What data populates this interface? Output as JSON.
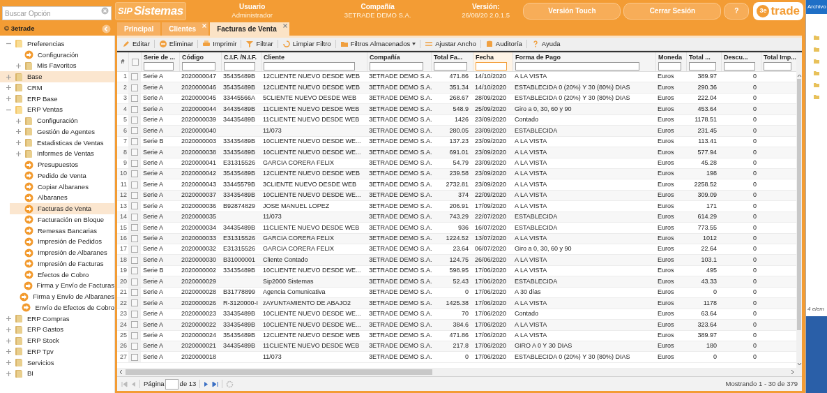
{
  "search": {
    "placeholder": "Buscar Opción"
  },
  "logo": {
    "mark": "SIP",
    "name": "Sistemas"
  },
  "header_fields": [
    {
      "label": "Usuario",
      "value": "Administrador"
    },
    {
      "label": "Compañía",
      "value": "3ETRADE DEMO S.A."
    },
    {
      "label": "Versión:",
      "value": "26/08/20 2.0.1.5"
    }
  ],
  "header_buttons": [
    "Versión Touch",
    "Cerrar Sesión",
    "?"
  ],
  "brand": {
    "mark": "3e",
    "name": "trade"
  },
  "sidebar_title": "© 3etrade",
  "tree": [
    {
      "label": "Preferencias",
      "kind": "folder",
      "expanded": true,
      "selected": false,
      "children": [
        {
          "label": "Configuración",
          "kind": "item",
          "selected": false
        },
        {
          "label": "Mis Favoritos",
          "kind": "folder",
          "expanded": false,
          "selected": false
        }
      ]
    },
    {
      "label": "Base",
      "kind": "folder",
      "expanded": false,
      "selected": true
    },
    {
      "label": "CRM",
      "kind": "folder",
      "expanded": false,
      "selected": false
    },
    {
      "label": "ERP Base",
      "kind": "folder",
      "expanded": false,
      "selected": false
    },
    {
      "label": "ERP Ventas",
      "kind": "folder",
      "expanded": true,
      "selected": false,
      "children": [
        {
          "label": "Configuración",
          "kind": "folder",
          "expanded": false,
          "selected": false
        },
        {
          "label": "Gestión de Agentes",
          "kind": "folder",
          "expanded": false,
          "selected": false
        },
        {
          "label": "Estadisticas de Ventas",
          "kind": "folder",
          "expanded": false,
          "selected": false
        },
        {
          "label": "Informes de Ventas",
          "kind": "folder",
          "expanded": false,
          "selected": false
        },
        {
          "label": "Presupuestos",
          "kind": "item",
          "selected": false
        },
        {
          "label": "Pedido de Venta",
          "kind": "item",
          "selected": false
        },
        {
          "label": "Copiar Albaranes",
          "kind": "item",
          "selected": false
        },
        {
          "label": "Albaranes",
          "kind": "item",
          "selected": false
        },
        {
          "label": "Facturas de Venta",
          "kind": "item",
          "selected": true
        },
        {
          "label": "Facturación en Bloque",
          "kind": "item",
          "selected": false
        },
        {
          "label": "Remesas Bancarias",
          "kind": "item",
          "selected": false
        },
        {
          "label": "Impresión de Pedidos",
          "kind": "item",
          "selected": false
        },
        {
          "label": "Impresión de Albaranes",
          "kind": "item",
          "selected": false
        },
        {
          "label": "Impresión de Facturas",
          "kind": "item",
          "selected": false
        },
        {
          "label": "Efectos de Cobro",
          "kind": "item",
          "selected": false
        },
        {
          "label": "Firma y Envío de Facturas",
          "kind": "item",
          "selected": false
        },
        {
          "label": "Firma y Envío de Albaranes",
          "kind": "item",
          "selected": false
        },
        {
          "label": "Envío de Efectos de Cobro",
          "kind": "item",
          "selected": false
        }
      ]
    },
    {
      "label": "ERP Compras",
      "kind": "folder",
      "expanded": false,
      "selected": false
    },
    {
      "label": "ERP Gastos",
      "kind": "folder",
      "expanded": false,
      "selected": false
    },
    {
      "label": "ERP Stock",
      "kind": "folder",
      "expanded": false,
      "selected": false
    },
    {
      "label": "ERP Tpv",
      "kind": "folder",
      "expanded": false,
      "selected": false
    },
    {
      "label": "Servicios",
      "kind": "folder",
      "expanded": false,
      "selected": false
    },
    {
      "label": "BI",
      "kind": "folder",
      "expanded": false,
      "selected": false
    }
  ],
  "tabs": [
    {
      "label": "Principal",
      "selected": false,
      "closable": false
    },
    {
      "label": "Clientes",
      "selected": false,
      "closable": true
    },
    {
      "label": "Facturas de Venta",
      "selected": true,
      "closable": true
    }
  ],
  "toolbar": [
    {
      "label": "Editar",
      "kind": "edit"
    },
    {
      "label": "Eliminar",
      "kind": "delete"
    },
    {
      "label": "Imprimir",
      "kind": "print"
    },
    {
      "label": "Filtrar",
      "kind": "filter"
    },
    {
      "label": "Limpiar Filtro",
      "kind": "clear"
    },
    {
      "label": "Filtros Almacenados",
      "kind": "stored"
    },
    {
      "label": "Ajustar Ancho",
      "kind": "width"
    },
    {
      "label": "Auditoría",
      "kind": "audit"
    },
    {
      "label": "Ayuda",
      "kind": "help"
    }
  ],
  "table": {
    "index_header": "#",
    "columns": [
      {
        "label": "Serie de ...",
        "kind": "text",
        "active": false
      },
      {
        "label": "Código",
        "kind": "text",
        "active": false
      },
      {
        "label": "C.I.F. /N.I.F.",
        "kind": "text",
        "active": false
      },
      {
        "label": "Cliente",
        "kind": "text",
        "active": false
      },
      {
        "label": "Compañía",
        "kind": "text",
        "active": false
      },
      {
        "label": "Total Fa...",
        "kind": "number",
        "active": false
      },
      {
        "label": "Fecha",
        "kind": "text",
        "active": true
      },
      {
        "label": "Forma de Pago",
        "kind": "text",
        "active": false
      },
      {
        "label": "Moneda",
        "kind": "text",
        "active": false
      },
      {
        "label": "Total ...",
        "kind": "number",
        "active": false
      },
      {
        "label": "Descu...",
        "kind": "number",
        "active": false
      },
      {
        "label": "Total Imp...",
        "active": false
      }
    ],
    "select_all": {
      "checked": false
    },
    "rows": [
      {
        "n": "1",
        "checked": false,
        "cells": [
          "Serie A",
          "2020000047",
          "35435489B",
          "12CLIENTE NUEVO DESDE WEB",
          "3ETRADE DEMO S.A.",
          "471.86",
          "14/10/2020",
          "A LA VISTA",
          "Euros",
          "389.97",
          "0"
        ]
      },
      {
        "n": "2",
        "checked": false,
        "cells": [
          "Serie A",
          "2020000046",
          "35435489B",
          "12CLIENTE NUEVO DESDE WEB",
          "3ETRADE DEMO S.A.",
          "351.34",
          "14/10/2020",
          "ESTABLECIDA 0 (20%) Y 30 (80%) DIAS",
          "Euros",
          "290.36",
          "0"
        ]
      },
      {
        "n": "3",
        "checked": false,
        "cells": [
          "Serie A",
          "2020000045",
          "33445566A",
          "5CLIENTE NUEVO DESDE WEB",
          "3ETRADE DEMO S.A.",
          "268.67",
          "28/09/2020",
          "ESTABLECIDA 0 (20%) Y 30 (80%) DIAS",
          "Euros",
          "222.04",
          "0"
        ]
      },
      {
        "n": "4",
        "checked": false,
        "cells": [
          "Serie A",
          "2020000044",
          "34435489B",
          "11CLIENTE NUEVO DESDE WEB",
          "3ETRADE DEMO S.A.",
          "548.9",
          "25/09/2020",
          "Giro a 0, 30, 60 y 90",
          "Euros",
          "453.64",
          "0"
        ]
      },
      {
        "n": "5",
        "checked": false,
        "cells": [
          "Serie A",
          "2020000039",
          "34435489B",
          "11CLIENTE NUEVO DESDE WEB",
          "3ETRADE DEMO S.A.",
          "1426",
          "23/09/2020",
          "Contado",
          "Euros",
          "1178.51",
          "0"
        ]
      },
      {
        "n": "6",
        "checked": false,
        "cells": [
          "Serie A",
          "2020000040",
          null,
          "11/073",
          "3ETRADE DEMO S.A.",
          "280.05",
          "23/09/2020",
          "ESTABLECIDA",
          "Euros",
          "231.45",
          "0"
        ]
      },
      {
        "n": "7",
        "checked": false,
        "cells": [
          "Serie B",
          "2020000003",
          "33435489B",
          "10CLIENTE NUEVO DESDE WE...",
          "3ETRADE DEMO S.A.",
          "137.23",
          "23/09/2020",
          "A LA VISTA",
          "Euros",
          "113.41",
          "0"
        ]
      },
      {
        "n": "8",
        "checked": false,
        "cells": [
          "Serie A",
          "2020000038",
          "33435489B",
          "10CLIENTE NUEVO DESDE WE...",
          "3ETRADE DEMO S.A.",
          "691.01",
          "23/09/2020",
          "A LA VISTA",
          "Euros",
          "577.94",
          "0"
        ]
      },
      {
        "n": "9",
        "checked": false,
        "cells": [
          "Serie A",
          "2020000041",
          "E31315526",
          "GARCIA CORERA FELIX",
          "3ETRADE DEMO S.A.",
          "54.79",
          "23/09/2020",
          "A LA VISTA",
          "Euros",
          "45.28",
          "0"
        ]
      },
      {
        "n": "10",
        "checked": false,
        "cells": [
          "Serie A",
          "2020000042",
          "35435489B",
          "12CLIENTE NUEVO DESDE WEB",
          "3ETRADE DEMO S.A.",
          "239.58",
          "23/09/2020",
          "A LA VISTA",
          "Euros",
          "198",
          "0"
        ]
      },
      {
        "n": "11",
        "checked": false,
        "cells": [
          "Serie A",
          "2020000043",
          "33445579B",
          "3CLIENTE NUEVO DESDE WEB",
          "3ETRADE DEMO S.A.",
          "2732.81",
          "23/09/2020",
          "A LA VISTA",
          "Euros",
          "2258.52",
          "0"
        ]
      },
      {
        "n": "12",
        "checked": false,
        "cells": [
          "Serie A",
          "2020000037",
          "33435489B",
          "10CLIENTE NUEVO DESDE WE...",
          "3ETRADE DEMO S.A.",
          "374",
          "22/09/2020",
          "A LA VISTA",
          "Euros",
          "309.09",
          "0"
        ]
      },
      {
        "n": "13",
        "checked": false,
        "cells": [
          "Serie A",
          "2020000036",
          "B92874829",
          "JOSE MANUEL LOPEZ",
          "3ETRADE DEMO S.A.",
          "206.91",
          "17/09/2020",
          "A LA VISTA",
          "Euros",
          "171",
          "0"
        ]
      },
      {
        "n": "14",
        "checked": false,
        "cells": [
          "Serie A",
          "2020000035",
          null,
          "11/073",
          "3ETRADE DEMO S.A.",
          "743.29",
          "22/07/2020",
          "ESTABLECIDA",
          "Euros",
          "614.29",
          "0"
        ]
      },
      {
        "n": "15",
        "checked": false,
        "cells": [
          "Serie A",
          "2020000034",
          "34435489B",
          "11CLIENTE NUEVO DESDE WEB",
          "3ETRADE DEMO S.A.",
          "936",
          "16/07/2020",
          "ESTABLECIDA",
          "Euros",
          "773.55",
          "0"
        ]
      },
      {
        "n": "16",
        "checked": false,
        "cells": [
          "Serie A",
          "2020000033",
          "E31315526",
          "GARCIA CORERA FELIX",
          "3ETRADE DEMO S.A.",
          "1224.52",
          "13/07/2020",
          "A LA VISTA",
          "Euros",
          "1012",
          "0"
        ]
      },
      {
        "n": "17",
        "checked": false,
        "cells": [
          "Serie A",
          "2020000032",
          "E31315526",
          "GARCIA CORERA FELIX",
          "3ETRADE DEMO S.A.",
          "23.64",
          "06/07/2020",
          "Giro a 0, 30, 60 y 90",
          "Euros",
          "22.64",
          "0"
        ]
      },
      {
        "n": "18",
        "checked": false,
        "cells": [
          "Serie A",
          "2020000030",
          "B31000001",
          "Cliente Contado",
          "3ETRADE DEMO S.A.",
          "124.75",
          "26/06/2020",
          "A LA VISTA",
          "Euros",
          "103.1",
          "0"
        ]
      },
      {
        "n": "19",
        "checked": false,
        "cells": [
          "Serie B",
          "2020000002",
          "33435489B",
          "10CLIENTE NUEVO DESDE WE...",
          "3ETRADE DEMO S.A.",
          "598.95",
          "17/06/2020",
          "A LA VISTA",
          "Euros",
          "495",
          "0"
        ]
      },
      {
        "n": "20",
        "checked": false,
        "cells": [
          "Serie A",
          "2020000029",
          null,
          "Sip2000 Sistemas",
          "3ETRADE DEMO S.A.",
          "52.43",
          "17/06/2020",
          "ESTABLECIDA",
          "Euros",
          "43.33",
          "0"
        ]
      },
      {
        "n": "21",
        "checked": false,
        "cells": [
          "Serie A",
          "2020000028",
          "B31778899",
          "Agencia Comunicativa",
          "3ETRADE DEMO S.A.",
          "0",
          "17/06/2020",
          "A 30 días",
          "Euros",
          "0",
          "0"
        ]
      },
      {
        "n": "22",
        "checked": false,
        "cells": [
          "Serie A",
          "2020000026",
          "R-3120000-I",
          "zAYUNTAMIENTO DE ABAJO2",
          "3ETRADE DEMO S.A.",
          "1425.38",
          "17/06/2020",
          "A LA VISTA",
          "Euros",
          "1178",
          "0"
        ]
      },
      {
        "n": "23",
        "checked": false,
        "cells": [
          "Serie A",
          "2020000023",
          "33435489B",
          "10CLIENTE NUEVO DESDE WE...",
          "3ETRADE DEMO S.A.",
          "70",
          "17/06/2020",
          "Contado",
          "Euros",
          "63.64",
          "0"
        ]
      },
      {
        "n": "24",
        "checked": false,
        "cells": [
          "Serie A",
          "2020000022",
          "33435489B",
          "10CLIENTE NUEVO DESDE WE...",
          "3ETRADE DEMO S.A.",
          "384.6",
          "17/06/2020",
          "A LA VISTA",
          "Euros",
          "323.64",
          "0"
        ]
      },
      {
        "n": "25",
        "checked": false,
        "cells": [
          "Serie A",
          "2020000024",
          "35435489B",
          "12CLIENTE NUEVO DESDE WEB",
          "3ETRADE DEMO S.A.",
          "471.86",
          "17/06/2020",
          "A LA VISTA",
          "Euros",
          "389.97",
          "0"
        ]
      },
      {
        "n": "26",
        "checked": false,
        "cells": [
          "Serie A",
          "2020000021",
          "34435489B",
          "11CLIENTE NUEVO DESDE WEB",
          "3ETRADE DEMO S.A.",
          "217.8",
          "17/06/2020",
          "GIRO A 0 Y 30 DIAS",
          "Euros",
          "180",
          "0"
        ]
      },
      {
        "n": "27",
        "checked": false,
        "cells": [
          "Serie A",
          "2020000018",
          null,
          "11/073",
          "3ETRADE DEMO S.A.",
          "0",
          "17/06/2020",
          "ESTABLECIDA 0 (20%) Y 30 (80%) DIAS",
          "Euros",
          "0",
          "0"
        ]
      }
    ]
  },
  "pager": {
    "page_label": "Página",
    "of_label": "de 13",
    "summary": "Mostrando 1 - 30 de 379"
  },
  "side_window": {
    "menu": "Archivo",
    "status": "4 elem"
  }
}
